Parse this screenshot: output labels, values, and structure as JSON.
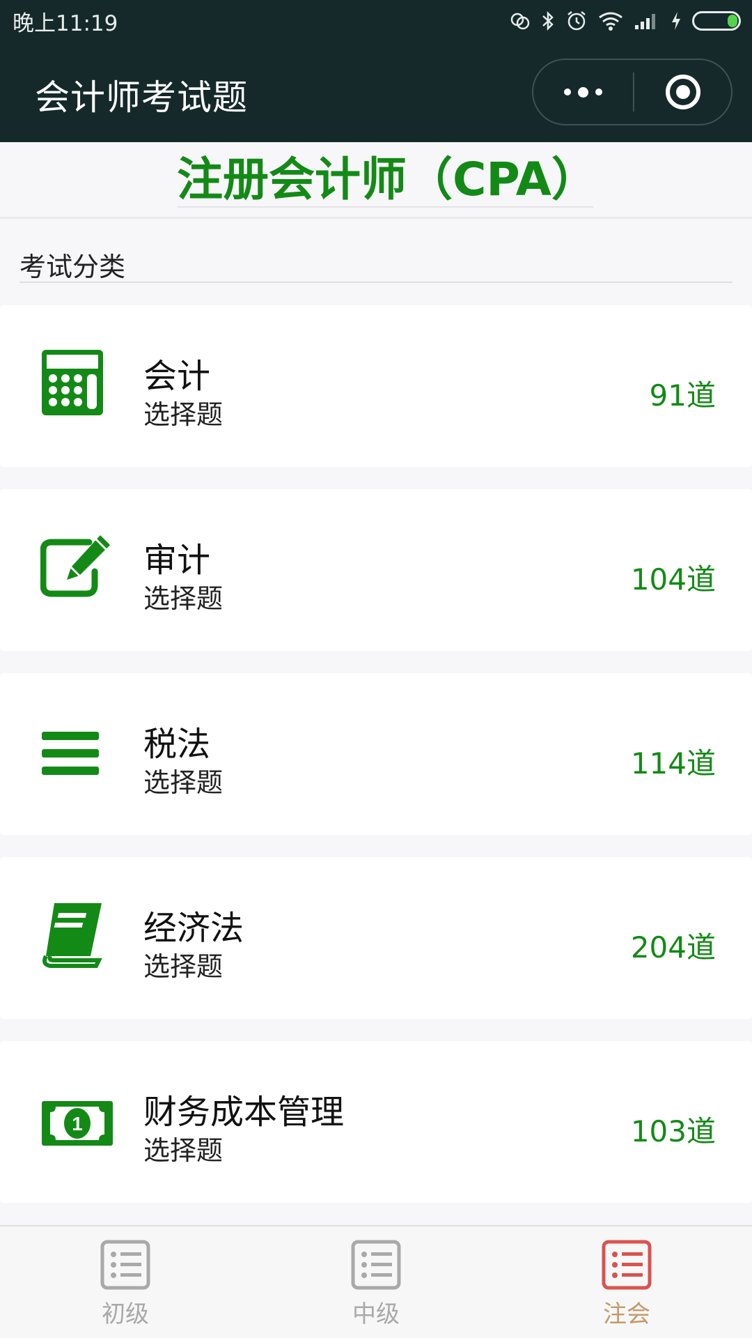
{
  "status_bar": {
    "time": "晚上11:19",
    "icons": [
      "sim-icon",
      "bluetooth-icon",
      "alarm-icon",
      "wifi-icon",
      "signal-icon",
      "charging-icon",
      "battery-icon"
    ]
  },
  "nav": {
    "title": "会计师考试题",
    "more_icon": "more-dots-icon",
    "close_icon": "target-circle-icon"
  },
  "heading": "注册会计师（CPA）",
  "section_label": "考试分类",
  "categories": [
    {
      "name": "会计",
      "type": "选择题",
      "count": "91道",
      "icon": "calculator-icon"
    },
    {
      "name": "审计",
      "type": "选择题",
      "count": "104道",
      "icon": "edit-icon"
    },
    {
      "name": "税法",
      "type": "选择题",
      "count": "114道",
      "icon": "menu-bars-icon"
    },
    {
      "name": "经济法",
      "type": "选择题",
      "count": "204道",
      "icon": "book-icon"
    },
    {
      "name": "财务成本管理",
      "type": "选择题",
      "count": "103道",
      "icon": "money-icon"
    }
  ],
  "tabs": [
    {
      "label": "初级",
      "icon": "list-icon",
      "active": false
    },
    {
      "label": "中级",
      "icon": "list-icon",
      "active": false
    },
    {
      "label": "注会",
      "icon": "list-icon",
      "active": true
    }
  ],
  "colors": {
    "header_bg": "#15292b",
    "accent_green": "#138a16",
    "active_tab_icon": "#d9534f",
    "active_tab_label": "#c49a6a",
    "inactive_tab": "#a9a9a9"
  }
}
